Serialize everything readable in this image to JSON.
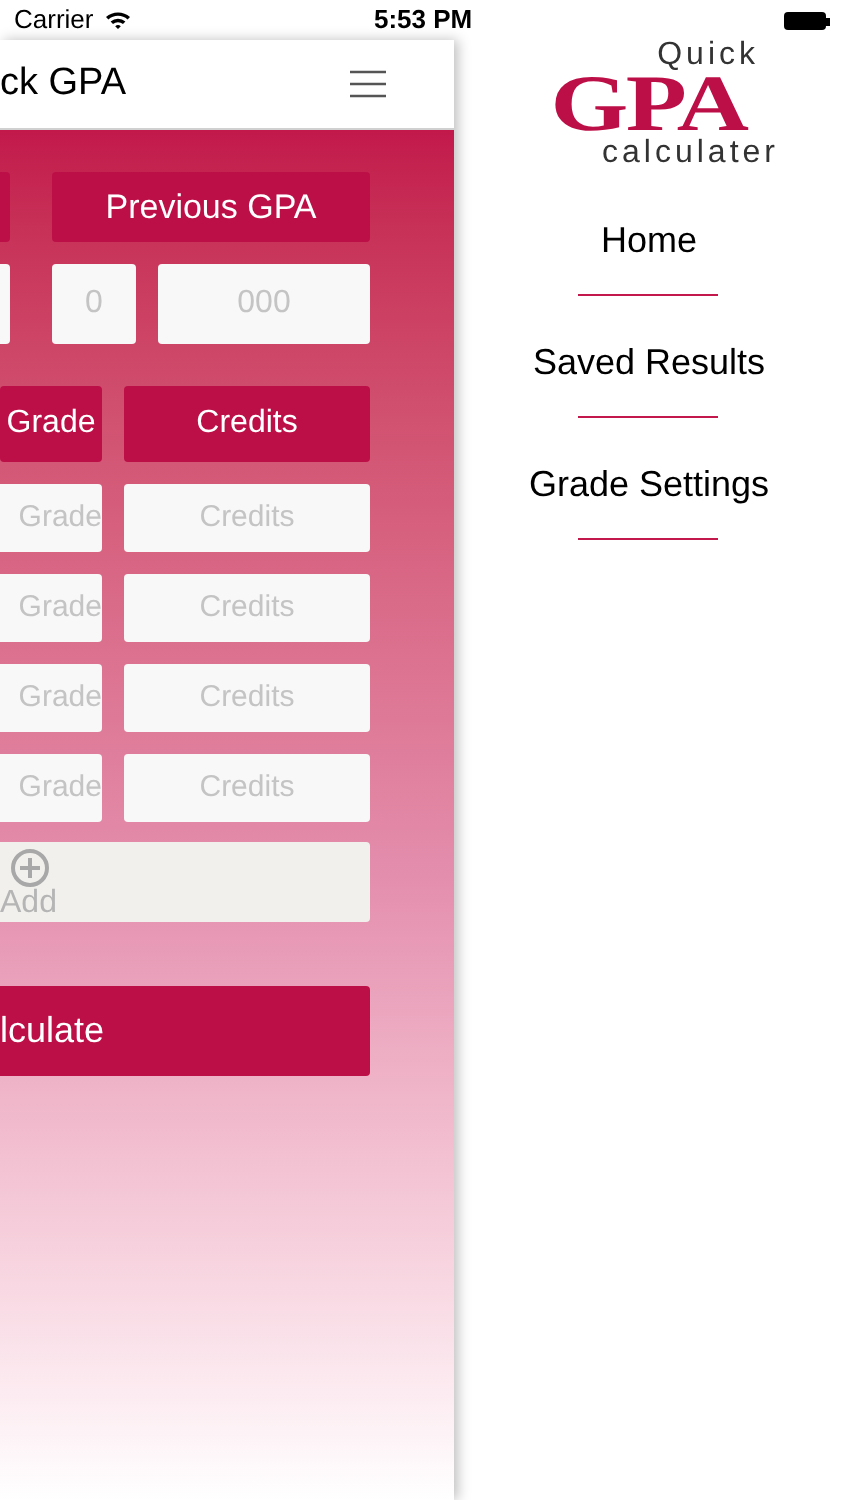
{
  "status_bar": {
    "carrier": "Carrier",
    "time": "5:53 PM"
  },
  "main": {
    "title": "ck GPA",
    "previous_gpa_label": "Previous GPA",
    "previous_fields": [
      {
        "placeholder": "0"
      },
      {
        "placeholder": "000"
      }
    ],
    "columns": [
      "Grade",
      "Credits"
    ],
    "course_rows": [
      {
        "grade_placeholder": "Grade",
        "credits_placeholder": "Credits"
      },
      {
        "grade_placeholder": "Grade",
        "credits_placeholder": "Credits"
      },
      {
        "grade_placeholder": "Grade",
        "credits_placeholder": "Credits"
      },
      {
        "grade_placeholder": "Grade",
        "credits_placeholder": "Credits"
      }
    ],
    "add_label": "Add",
    "calculate_label": "lculate"
  },
  "menu": {
    "logo": {
      "top": "Quick",
      "main": "GPA",
      "bottom": "calculater"
    },
    "items": [
      {
        "label": "Home"
      },
      {
        "label": "Saved Results"
      },
      {
        "label": "Grade Settings"
      }
    ]
  }
}
